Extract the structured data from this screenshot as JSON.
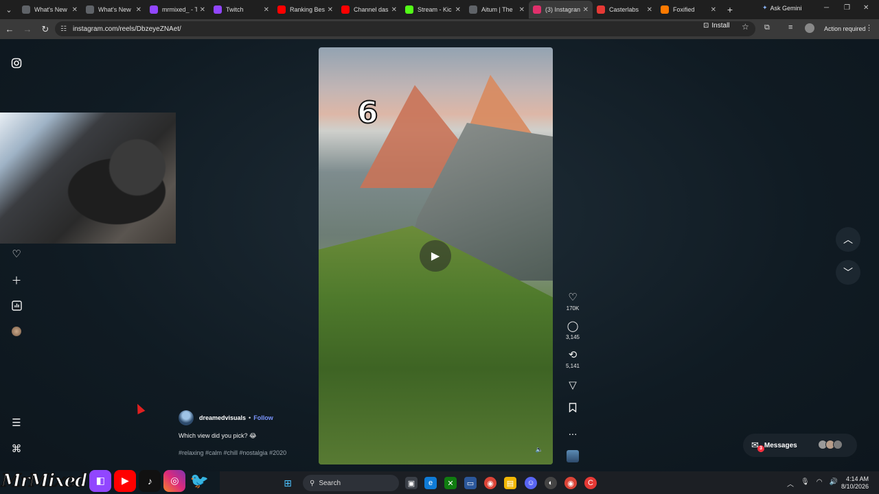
{
  "browser": {
    "tabs": [
      {
        "label": "What's New",
        "color": "#5f6368"
      },
      {
        "label": "What's New",
        "color": "#5f6368"
      },
      {
        "label": "mrmixed_ - T",
        "color": "#9146ff"
      },
      {
        "label": "Twitch",
        "color": "#9146ff"
      },
      {
        "label": "Ranking Bes",
        "color": "#ff0000"
      },
      {
        "label": "Channel das",
        "color": "#ff0000"
      },
      {
        "label": "Stream - Kic",
        "color": "#53fc18"
      },
      {
        "label": "Aitum | The",
        "color": "#5f6368"
      },
      {
        "label": "(3) Instagran",
        "color": "#e1306c"
      },
      {
        "label": "Casterlabs",
        "color": "#e53935"
      },
      {
        "label": "Foxified",
        "color": "#ff7a00"
      }
    ],
    "active_tab_index": 8,
    "new_tab": "+",
    "ask_gemini": "Ask Gemini",
    "url": "instagram.com/reels/DbzeyeZNAet/",
    "install_label": "Install",
    "action_required": "Action required"
  },
  "sidebar": {
    "icons": [
      "instagram-icon",
      "heart-icon",
      "plus-icon",
      "insights-icon",
      "profile-icon",
      "menu-icon",
      "more-apps-icon"
    ]
  },
  "reel": {
    "overlay_number": "6",
    "creator": "dreamedvisuals",
    "separator": "•",
    "follow_label": "Follow",
    "caption": "Which view did you pick? 😂",
    "hashtags": "#relaxing #calm #chill #nostalgia #2020"
  },
  "actions": {
    "likes": "170K",
    "comments": "3,145",
    "reposts": "5,141",
    "more": "..."
  },
  "messages": {
    "label": "Messages",
    "badge": "3"
  },
  "stream": {
    "brand": "MrMixed"
  },
  "taskbar": {
    "search_label": "Search",
    "time": "4:14 AM",
    "date": "8/10/2026"
  },
  "colors": {
    "follow": "#7b95ff",
    "badge": "#ff3040",
    "page_bg": "#101b23"
  }
}
